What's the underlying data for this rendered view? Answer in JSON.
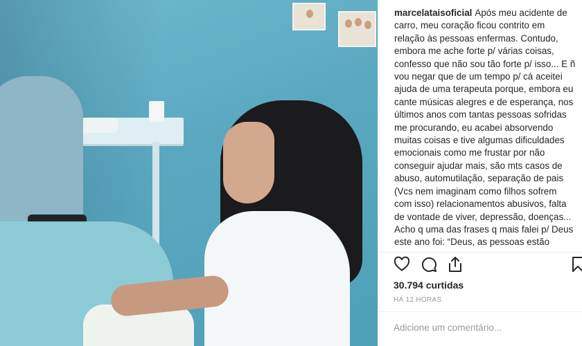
{
  "post": {
    "username": "marcelataisoficial",
    "caption": "Após meu acidente de carro, meu coração ficou contrito em relação às pessoas enfermas. Contudo, embora me ache forte p/ várias coisas, confesso que não sou tão forte p/ isso... E ñ vou negar que de um tempo p/ cá aceitei ajuda de uma terapeuta porque, embora eu cante músicas alegres e de esperança, nos últimos anos com tantas pessoas sofridas me procurando, eu acabei absorvendo muitas coisas e tive algumas dificuldades emocionais como me frustar por não conseguir ajudar mais, são mts casos de abuso, automutilação, separação de pais (Vcs nem imaginam como filhos sofrem com isso) relacionamentos abusivos, falta de vontade de viver, depressão, doenças... Acho q uma das frases q mais falei p/ Deus este ano foi: “Deus, as pessoas estão sofrendo demais.” Não quero expor nem",
    "likes": "30.794 curtidas",
    "time": "HÁ 12 HORAS"
  },
  "actions": {
    "like_icon": "heart-icon",
    "comment_icon": "comment-bubble-icon",
    "share_icon": "share-icon",
    "save_icon": "bookmark-icon"
  },
  "comment_box": {
    "placeholder": "Adicione um comentário..."
  }
}
